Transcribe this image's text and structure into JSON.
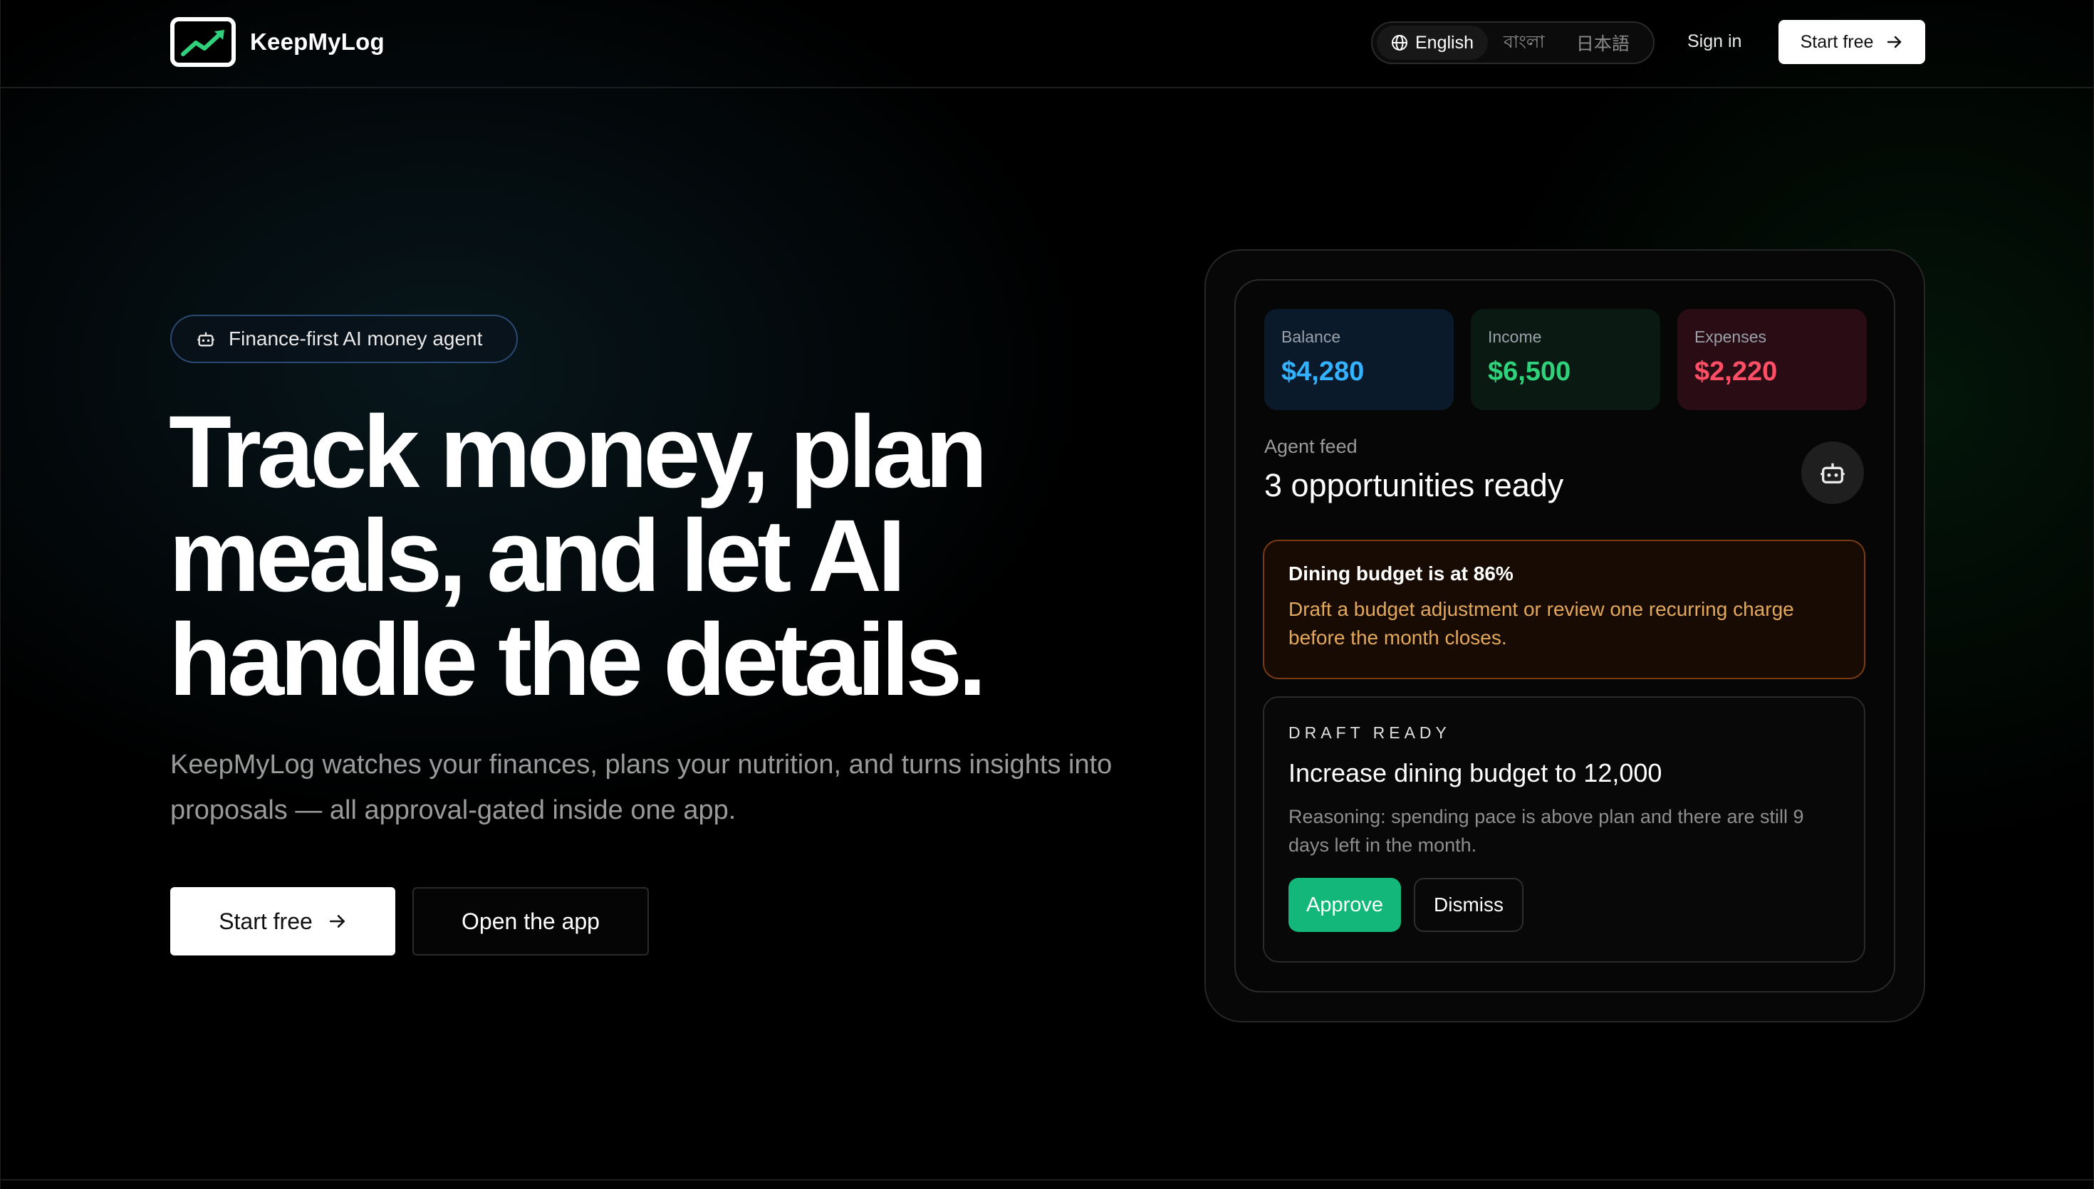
{
  "nav": {
    "brand": "KeepMyLog",
    "languages": [
      "English",
      "বাংলা",
      "日本語"
    ],
    "sign_in": "Sign in",
    "start_free": "Start free"
  },
  "hero": {
    "badge": "Finance-first AI money agent",
    "headline_lines": [
      "Track money, plan",
      "meals, and let AI",
      "handle the details."
    ],
    "subtitle": "KeepMyLog watches your finances, plans your nutrition, and turns insights into proposals — all approval-gated inside one app.",
    "primary_cta": "Start free",
    "secondary_cta": "Open the app"
  },
  "dashboard": {
    "stats": [
      {
        "label": "Balance",
        "value": "$4,280"
      },
      {
        "label": "Income",
        "value": "$6,500"
      },
      {
        "label": "Expenses",
        "value": "$2,220"
      }
    ],
    "feed_label": "Agent feed",
    "feed_title": "3 opportunities ready",
    "alert": {
      "title": "Dining budget is at 86%",
      "body": "Draft a budget adjustment or review one recurring charge before the month closes."
    },
    "draft": {
      "kicker": "DRAFT READY",
      "title": "Increase dining budget to 12,000",
      "body": "Reasoning: spending pace is above plan and there are still 9 days left in the month.",
      "approve": "Approve",
      "dismiss": "Dismiss"
    }
  },
  "colors": {
    "balance": "#33b3ff",
    "income": "#2fd27a",
    "expenses": "#ff4f66",
    "approve": "#13b77a",
    "alert_border": "#7a3a12",
    "alert_text": "#e3a85a",
    "logo_accent": "#2fd27a"
  },
  "icons": {
    "logo": "chart-trend-icon",
    "language": "globe-icon",
    "arrow": "arrow-right-icon",
    "agent": "robot-icon"
  }
}
